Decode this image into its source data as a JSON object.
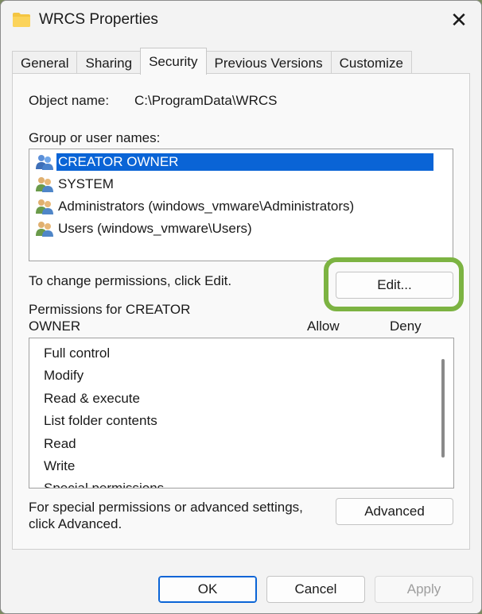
{
  "window": {
    "title": "WRCS Properties",
    "close_glyph": "✕"
  },
  "tabs": [
    {
      "label": "General"
    },
    {
      "label": "Sharing"
    },
    {
      "label": "Security",
      "active": true
    },
    {
      "label": "Previous Versions"
    },
    {
      "label": "Customize"
    }
  ],
  "security": {
    "object_name_label": "Object name:",
    "object_name_value": "C:\\ProgramData\\WRCS",
    "group_label": "Group or user names:",
    "users": [
      {
        "name": "CREATOR OWNER",
        "selected": true,
        "icon": "user-group-icon"
      },
      {
        "name": "SYSTEM",
        "icon": "user-group-icon"
      },
      {
        "name": "Administrators (windows_vmware\\Administrators)",
        "icon": "user-group-icon"
      },
      {
        "name": "Users (windows_vmware\\Users)",
        "icon": "user-group-icon"
      }
    ],
    "change_hint": "To change permissions, click Edit.",
    "edit_label": "Edit...",
    "permissions_for_line1": "Permissions for CREATOR",
    "permissions_for_line2": "OWNER",
    "allow_header": "Allow",
    "deny_header": "Deny",
    "permissions": [
      "Full control",
      "Modify",
      "Read & execute",
      "List folder contents",
      "Read",
      "Write",
      "Special permissions"
    ],
    "advanced_hint_line1": "For special permissions or advanced settings,",
    "advanced_hint_line2": "click Advanced.",
    "advanced_label": "Advanced"
  },
  "footer": {
    "ok_label": "OK",
    "cancel_label": "Cancel",
    "apply_label": "Apply"
  },
  "colors": {
    "selection": "#0a64d6",
    "highlight_ring": "#7cb342"
  }
}
